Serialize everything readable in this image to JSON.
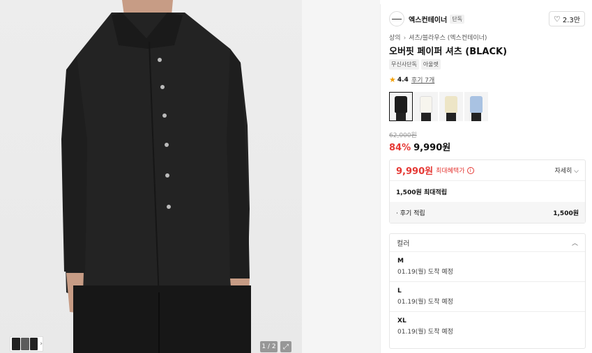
{
  "gallery": {
    "counter": "1 / 2",
    "expand_icon": "expand-icon"
  },
  "brand": {
    "name": "엑스컨테이너",
    "badge": "단독",
    "likes": "2.3만"
  },
  "breadcrumb": {
    "items": [
      "상의",
      "셔츠/블라우스 (엑스컨테이너)"
    ]
  },
  "product": {
    "title": "오버핏 페이퍼 셔츠 (BLACK)",
    "tags": [
      "무신사단독",
      "아울렛"
    ],
    "rating": "4.4",
    "reviews": "후기 7개",
    "swatches": [
      {
        "color": "#1c1c1c",
        "selected": true
      },
      {
        "color": "#f4f2ea",
        "selected": false
      },
      {
        "color": "#eee6c8",
        "selected": false
      },
      {
        "color": "#a9c2e2",
        "selected": false
      }
    ],
    "original_price": "62,000원",
    "discount": "84%",
    "price": "9,990원"
  },
  "benefit": {
    "price": "9,990원",
    "label": "최대혜택가",
    "detail": "자세히",
    "points": "1,500원 최대적립",
    "review_label": "· 후기 적립",
    "review_amount": "1,500원"
  },
  "options": {
    "header": "컬러",
    "items": [
      {
        "size": "M",
        "eta": "01.19(월) 도착 예정"
      },
      {
        "size": "L",
        "eta": "01.19(월) 도착 예정"
      },
      {
        "size": "XL",
        "eta": "01.19(월) 도착 예정"
      }
    ]
  },
  "colors": {
    "accent": "#e53935",
    "star": "#f2a008"
  }
}
